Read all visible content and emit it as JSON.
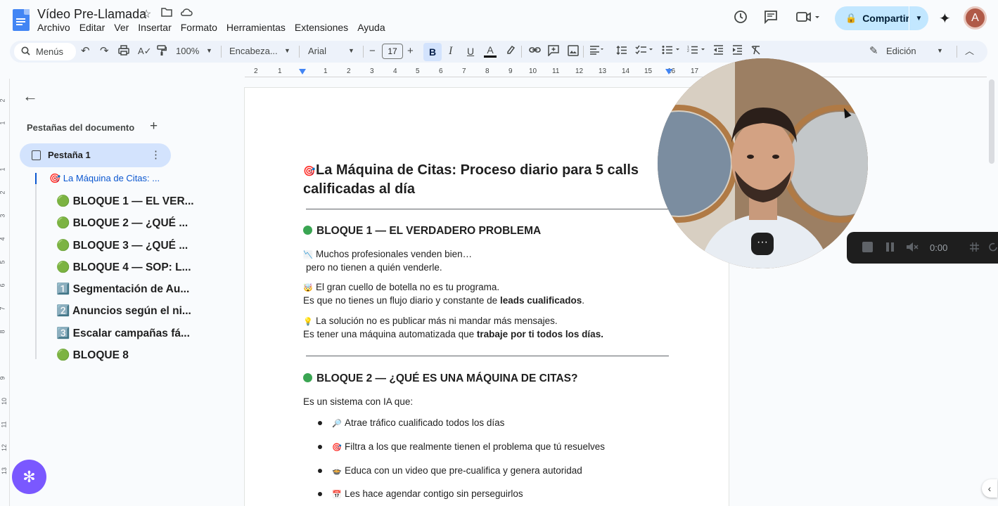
{
  "doc": {
    "title": "Vídeo Pre-Llamada",
    "menus": [
      "Archivo",
      "Editar",
      "Ver",
      "Insertar",
      "Formato",
      "Herramientas",
      "Extensiones",
      "Ayuda"
    ],
    "share_label": "Compartir",
    "avatar_letter": "A"
  },
  "toolbar": {
    "search_placeholder": "Menús",
    "zoom": "100%",
    "style": "Encabeza...",
    "font": "Arial",
    "font_size": "17",
    "bold_label": "B",
    "italic_label": "I",
    "underline_label": "U",
    "text_color_label": "A",
    "mode": "Edición"
  },
  "ruler": {
    "ticks": [
      "2",
      "1",
      "1",
      "2",
      "3",
      "4",
      "5",
      "6",
      "7",
      "8",
      "9",
      "10",
      "11",
      "12",
      "13",
      "14",
      "15",
      "16",
      "17"
    ],
    "left_ticks": [
      "2",
      "1",
      "1",
      "2",
      "3",
      "4",
      "5",
      "6",
      "7",
      "8",
      "9",
      "10",
      "11",
      "12",
      "13"
    ]
  },
  "sidebar": {
    "heading": "Pestañas del documento",
    "tab_label": "Pestaña 1",
    "outline": [
      "🎯 La Máquina de Citas: ...",
      "🟢 BLOQUE 1 — EL VER...",
      "🟢 BLOQUE 2 — ¿QUÉ ...",
      "🟢 BLOQUE 3 — ¿QUÉ ...",
      "🟢 BLOQUE 4 — SOP: L...",
      "1️⃣ Segmentación de Au...",
      "2️⃣ Anuncios según el ni...",
      "3️⃣ Escalar campañas fá...",
      "🟢 BLOQUE 8"
    ]
  },
  "content": {
    "title_emoji": "🎯",
    "title_line1": "La Máquina de Citas: Proceso diario para 5 calls",
    "title_line2": "calificadas al día",
    "block1_heading": "BLOQUE 1 — EL VERDADERO PROBLEMA",
    "p1_emoji": "📉",
    "p1_line1": "Muchos profesionales venden bien…",
    "p1_line2": "pero no tienen a quién venderle.",
    "p2_emoji": "🤯",
    "p2_line1": "El gran cuello de botella no es tu programa.",
    "p2_line2_a": "Es que no tienes un flujo diario y constante de ",
    "p2_line2_b": "leads cualificados",
    "p2_line2_c": ".",
    "p3_emoji": "💡",
    "p3_line1": "La solución no es publicar más ni mandar más mensajes.",
    "p3_line2_a": "Es tener una máquina automatizada que ",
    "p3_line2_b": "trabaje por ti todos los días.",
    "block2_heading": "BLOQUE 2 — ¿QUÉ ES UNA MÁQUINA DE CITAS?",
    "p4": "Es un sistema con IA que:",
    "bullets": [
      {
        "emoji": "🔎",
        "text": "Atrae tráfico cualificado todos los días"
      },
      {
        "emoji": "🎯",
        "text": "Filtra a los que realmente tienen el problema que tú resuelves"
      },
      {
        "emoji": "🍲",
        "text": "Educa con un video que pre-cualifica y genera autoridad"
      },
      {
        "emoji": "📅",
        "text": "Les hace agendar contigo sin perseguirlos"
      }
    ]
  },
  "recorder": {
    "time": "0:00"
  },
  "colors": {
    "accent": "#0b57d0",
    "share_bg": "#c2e7ff",
    "toolbar_bg": "#edf2fa",
    "green_dot": "#3aa552",
    "fab": "#7a58ff"
  }
}
